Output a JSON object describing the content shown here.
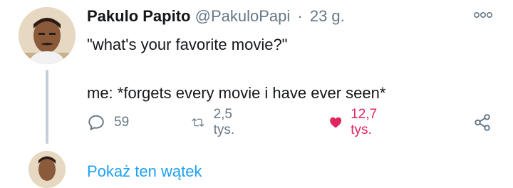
{
  "tweet": {
    "author_name": "Pakulo Papito",
    "author_handle": "@PakuloPapi",
    "separator": "·",
    "time": "23 g.",
    "text": "\"what's your favorite movie?\"\n\nme: *forgets every movie i have ever seen*",
    "reply_count": "59",
    "retweet_count": "2,5 tys.",
    "like_count": "12,7 tys.",
    "liked": true
  },
  "thread": {
    "show_thread_label": "Pokaż ten wątek"
  },
  "icons": {
    "more": "more-options-icon",
    "reply": "reply-icon",
    "retweet": "retweet-icon",
    "like": "heart-icon",
    "share": "share-icon"
  },
  "colors": {
    "text_primary": "#14171a",
    "text_secondary": "#657786",
    "like_active": "#e0245e",
    "link": "#1da1f2",
    "thread_line": "#c4cfd6"
  }
}
